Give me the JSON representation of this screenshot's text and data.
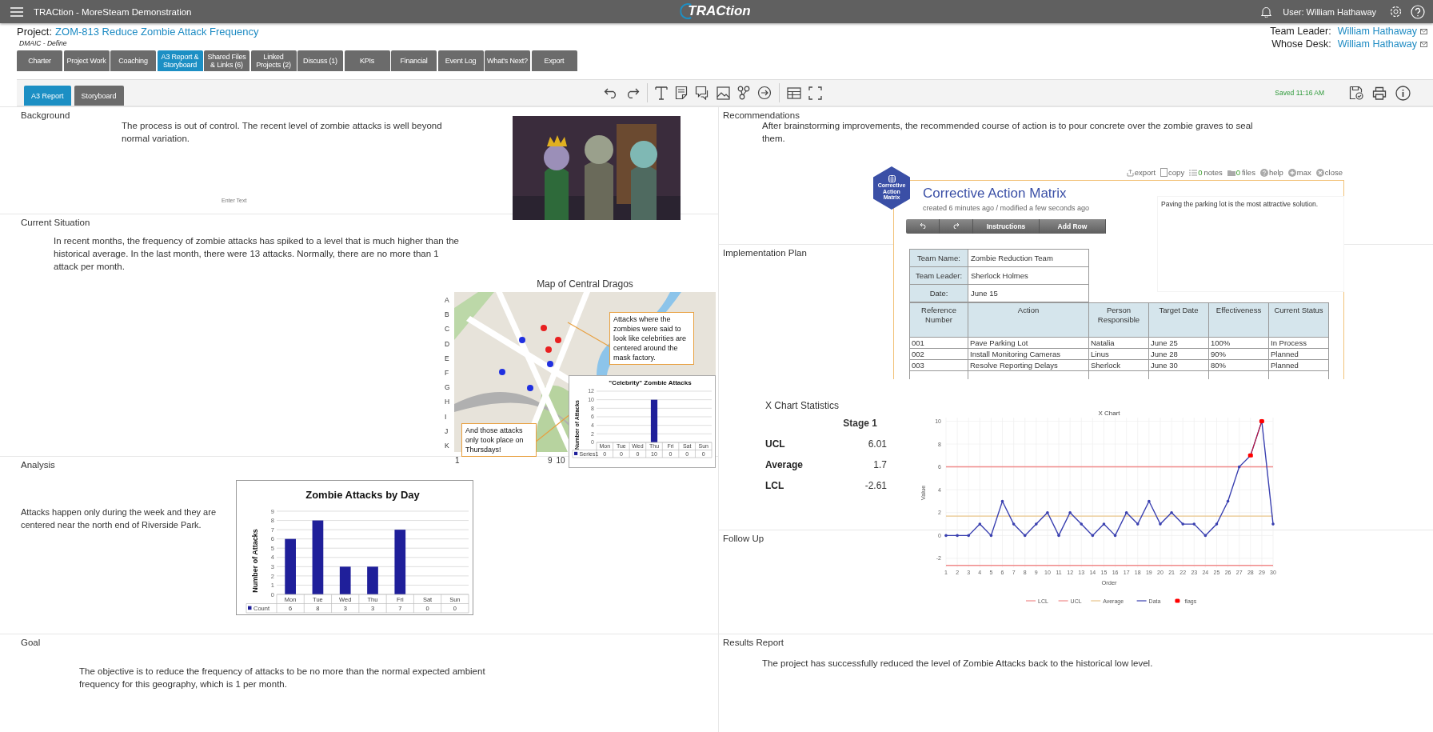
{
  "app_bar": {
    "title": "TRACtion - MoreSteam Demonstration",
    "logo": "TRACtion",
    "user": "User: William Hathaway"
  },
  "project": {
    "label": "Project:",
    "name": "ZOM-813 Reduce Zombie Attack Frequency",
    "phase": "DMAIC - Define"
  },
  "people": [
    {
      "label": "Team Leader:",
      "name": "William Hathaway"
    },
    {
      "label": "Whose Desk:",
      "name": "William Hathaway"
    }
  ],
  "tabs": [
    {
      "label": "Charter",
      "selected": false
    },
    {
      "label": "Project Work",
      "selected": false
    },
    {
      "label": "Coaching",
      "selected": false
    },
    {
      "label": "A3 Report & Storyboard",
      "selected": true
    },
    {
      "label": "Shared Files & Links (6)",
      "selected": false
    },
    {
      "label": "Linked Projects (2)",
      "selected": false
    },
    {
      "label": "Discuss (1)",
      "selected": false
    },
    {
      "label": "KPIs",
      "selected": false
    },
    {
      "label": "Financial",
      "selected": false
    },
    {
      "label": "Event Log",
      "selected": false
    },
    {
      "label": "What's Next?",
      "selected": false
    },
    {
      "label": "Export",
      "selected": false
    }
  ],
  "report_tabs": [
    {
      "label": "A3 Report",
      "selected": true
    },
    {
      "label": "Storyboard",
      "selected": false
    }
  ],
  "save_status": "Saved 11:16 AM",
  "sections_left": [
    {
      "title": "Background",
      "text": "The process is out of control. The recent level of zombie attacks is well beyond normal variation.",
      "placeholder": "Enter Text"
    },
    {
      "title": "Current Situation",
      "text": "In recent months, the frequency of zombie attacks has spiked to a level that is much higher than the historical average. In the last month, there were 13 attacks. Normally, there are no more than 1 attack per month."
    },
    {
      "title": "Analysis",
      "text": "Attacks happen only during the week and they are centered near the north end of Riverside Park."
    },
    {
      "title": "Goal",
      "text": "The objective is to reduce the frequency of attacks to be no more than the normal expected ambient frequency for this geography, which is 1 per month."
    }
  ],
  "sections_right": [
    {
      "title": "Recommendations",
      "text": "After brainstorming improvements, the recommended course of action is to pour concrete over the zombie graves to seal them."
    },
    {
      "title": "Implementation Plan"
    },
    {
      "title": "Follow Up"
    },
    {
      "title": "Results Report",
      "text": "The project has successfully reduced the level of Zombie Attacks back to the historical low level."
    }
  ],
  "map": {
    "title": "Map of Central Dragos",
    "rows": [
      "A",
      "B",
      "C",
      "D",
      "E",
      "F",
      "G",
      "H",
      "I",
      "J",
      "K"
    ],
    "columns": [
      "1",
      "9",
      "10"
    ],
    "callouts": [
      "Attacks where the zombies were said to look like celebrities are centered around the mask factory.",
      "And those attacks only took place on Thursdays!"
    ],
    "chart_data": {
      "type": "bar",
      "title": "\"Celebrity\" Zombie Attacks",
      "ylabel": "Number of Attacks",
      "categories": [
        "Mon",
        "Tue",
        "Wed",
        "Thu",
        "Fri",
        "Sat",
        "Sun"
      ],
      "series": [
        {
          "name": "Series1",
          "color": "#1f1f9a",
          "values": [
            0,
            0,
            0,
            10,
            0,
            0,
            0
          ]
        }
      ],
      "ylim": [
        0,
        12
      ],
      "yticks": [
        0,
        2,
        4,
        6,
        8,
        10,
        12
      ],
      "grid": true,
      "data_labels": true
    }
  },
  "attacks_chart": {
    "chart_data": {
      "type": "bar",
      "title": "Zombie Attacks by Day",
      "ylabel": "Number of Attacks",
      "categories": [
        "Mon",
        "Tue",
        "Wed",
        "Thu",
        "Fri",
        "Sat",
        "Sun"
      ],
      "series": [
        {
          "name": "Count",
          "color": "#1f1f9a",
          "values": [
            6,
            8,
            3,
            3,
            7,
            0,
            0
          ]
        }
      ],
      "ylim": [
        0,
        9
      ],
      "yticks": [
        0,
        1,
        2,
        3,
        4,
        5,
        6,
        7,
        8,
        9
      ],
      "grid": true,
      "data_labels": true
    }
  },
  "action_matrix": {
    "actions": [
      {
        "kind": "export",
        "label": "export"
      },
      {
        "kind": "copy",
        "label": "copy"
      },
      {
        "kind": "notes",
        "count": "0",
        "label": "notes"
      },
      {
        "kind": "files",
        "count": "0",
        "label": "files"
      },
      {
        "kind": "help",
        "label": "help"
      },
      {
        "kind": "max",
        "label": "max"
      },
      {
        "kind": "close",
        "label": "close"
      }
    ],
    "logo": "Corrective Action Matrix",
    "title": "Corrective Action Matrix",
    "meta": "created 6 minutes ago / modified a few seconds ago",
    "buttons": [
      "Instructions",
      "Add Row"
    ],
    "note": "Paving the parking lot is the most attractive solution.",
    "info": [
      {
        "label": "Team Name:",
        "value": "Zombie Reduction Team"
      },
      {
        "label": "Team Leader:",
        "value": "Sherlock Holmes"
      },
      {
        "label": "Date:",
        "value": "June 15"
      }
    ],
    "columns": [
      "Reference Number",
      "Action",
      "Person Responsible",
      "Target Date",
      "Effectiveness",
      "Current Status"
    ],
    "rows": [
      [
        "001",
        "Pave Parking Lot",
        "Natalia",
        "June 25",
        "100%",
        "In Process"
      ],
      [
        "002",
        "Install Monitoring Cameras",
        "Linus",
        "June 28",
        "90%",
        "Planned"
      ],
      [
        "003",
        "Resolve Reporting Delays",
        "Sherlock",
        "June 30",
        "80%",
        "Planned"
      ]
    ]
  },
  "x_chart_statistics": {
    "title": "X Chart Statistics",
    "stage": "Stage 1",
    "rows": [
      {
        "label": "UCL",
        "value": "6.01"
      },
      {
        "label": "Average",
        "value": "1.7"
      },
      {
        "label": "LCL",
        "value": "-2.61"
      }
    ]
  },
  "x_chart": {
    "chart_data": {
      "type": "line",
      "title": "X Chart",
      "xlabel": "Order",
      "ylabel": "Value",
      "x": [
        1,
        2,
        3,
        4,
        5,
        6,
        7,
        8,
        9,
        10,
        11,
        12,
        13,
        14,
        15,
        16,
        17,
        18,
        19,
        20,
        21,
        22,
        23,
        24,
        25,
        26,
        27,
        28,
        29,
        30
      ],
      "legend": "bottom",
      "series": [
        {
          "name": "LCL",
          "color": "#f08a8a",
          "values": [
            -2.61,
            -2.61,
            -2.61,
            -2.61,
            -2.61,
            -2.61,
            -2.61,
            -2.61,
            -2.61,
            -2.61,
            -2.61,
            -2.61,
            -2.61,
            -2.61,
            -2.61,
            -2.61,
            -2.61,
            -2.61,
            -2.61,
            -2.61,
            -2.61,
            -2.61,
            -2.61,
            -2.61,
            -2.61,
            -2.61,
            -2.61,
            -2.61,
            -2.61,
            -2.61
          ]
        },
        {
          "name": "UCL",
          "color": "#f08a8a",
          "values": [
            6.01,
            6.01,
            6.01,
            6.01,
            6.01,
            6.01,
            6.01,
            6.01,
            6.01,
            6.01,
            6.01,
            6.01,
            6.01,
            6.01,
            6.01,
            6.01,
            6.01,
            6.01,
            6.01,
            6.01,
            6.01,
            6.01,
            6.01,
            6.01,
            6.01,
            6.01,
            6.01,
            6.01,
            6.01,
            6.01
          ]
        },
        {
          "name": "Average",
          "color": "#e8c48a",
          "values": [
            1.7,
            1.7,
            1.7,
            1.7,
            1.7,
            1.7,
            1.7,
            1.7,
            1.7,
            1.7,
            1.7,
            1.7,
            1.7,
            1.7,
            1.7,
            1.7,
            1.7,
            1.7,
            1.7,
            1.7,
            1.7,
            1.7,
            1.7,
            1.7,
            1.7,
            1.7,
            1.7,
            1.7,
            1.7,
            1.7
          ]
        },
        {
          "name": "Data",
          "color": "#3a40b0",
          "values": [
            0,
            0,
            0,
            1,
            0,
            3,
            1,
            0,
            1,
            2,
            0,
            2,
            1,
            0,
            1,
            0,
            2,
            1,
            3,
            1,
            2,
            1,
            1,
            0,
            1,
            3,
            6,
            7,
            10,
            1
          ]
        },
        {
          "name": "flags",
          "color": "#ff0000",
          "marker": "square",
          "values": [
            null,
            null,
            null,
            null,
            null,
            null,
            null,
            null,
            null,
            null,
            null,
            null,
            null,
            null,
            null,
            null,
            null,
            null,
            null,
            null,
            null,
            null,
            null,
            null,
            null,
            null,
            null,
            7,
            10,
            null
          ]
        }
      ],
      "grid": true,
      "xlim": [
        1,
        30
      ],
      "ylim": [
        -2.8,
        10.3
      ],
      "xticks": [
        1,
        2,
        3,
        4,
        5,
        6,
        7,
        8,
        9,
        10,
        11,
        12,
        13,
        14,
        15,
        16,
        17,
        18,
        19,
        20,
        21,
        22,
        23,
        24,
        25,
        26,
        27,
        28,
        29,
        30
      ],
      "yticks": [
        -2,
        0,
        2,
        4,
        6,
        8,
        10
      ]
    }
  }
}
